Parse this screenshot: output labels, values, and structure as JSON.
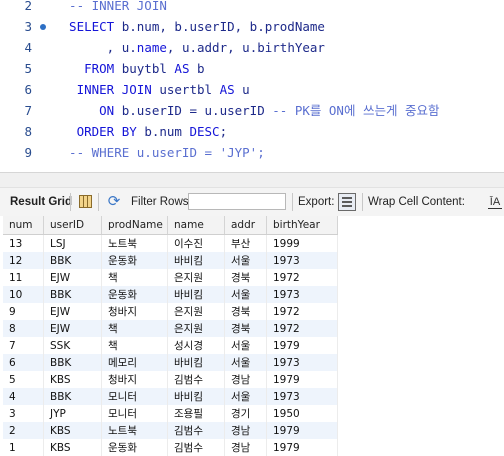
{
  "editor": {
    "lines": [
      {
        "num": "2",
        "segments": [
          {
            "t": "  -- INNER JOIN",
            "c": "cmt"
          }
        ]
      },
      {
        "num": "3",
        "marker": true,
        "segments": [
          {
            "t": "  SELECT ",
            "c": "kw"
          },
          {
            "t": "b.num, b.userID, b.prodName",
            "c": "id"
          }
        ]
      },
      {
        "num": "4",
        "segments": [
          {
            "t": "       , u.",
            "c": "id"
          },
          {
            "t": "name",
            "c": "kw"
          },
          {
            "t": ", u.addr, u.birthYear",
            "c": "id"
          }
        ]
      },
      {
        "num": "5",
        "segments": [
          {
            "t": "    FROM ",
            "c": "kw"
          },
          {
            "t": "buytbl ",
            "c": "id"
          },
          {
            "t": "AS ",
            "c": "kw"
          },
          {
            "t": "b",
            "c": "id"
          }
        ]
      },
      {
        "num": "6",
        "segments": [
          {
            "t": "   INNER JOIN ",
            "c": "kw"
          },
          {
            "t": "usertbl ",
            "c": "id"
          },
          {
            "t": "AS ",
            "c": "kw"
          },
          {
            "t": "u",
            "c": "id"
          }
        ]
      },
      {
        "num": "7",
        "segments": [
          {
            "t": "      ON ",
            "c": "kw"
          },
          {
            "t": "b.userID = u.userID ",
            "c": "id"
          },
          {
            "t": "-- PK를 ON에 쓰는게 중요함",
            "c": "cmt"
          }
        ]
      },
      {
        "num": "8",
        "segments": [
          {
            "t": "   ORDER BY ",
            "c": "kw"
          },
          {
            "t": "b.num ",
            "c": "id"
          },
          {
            "t": "DESC",
            "c": "kw"
          },
          {
            "t": ";",
            "c": "id"
          }
        ]
      },
      {
        "num": "9",
        "segments": [
          {
            "t": "  -- WHERE u.userID = 'JYP';",
            "c": "cmt"
          }
        ]
      }
    ]
  },
  "toolbar": {
    "result_grid_label": "Result Grid",
    "grid_icon": "grid-icon",
    "refresh_icon": "refresh-icon",
    "filter_label": "Filter Rows:",
    "filter_value": "",
    "export_label": "Export:",
    "export_icon": "export-icon",
    "wrap_label": "Wrap Cell Content:",
    "wrap_icon": "wrap-icon"
  },
  "grid": {
    "columns": [
      "num",
      "userID",
      "prodName",
      "name",
      "addr",
      "birthYear"
    ],
    "rows": [
      [
        "13",
        "LSJ",
        "노트북",
        "이수진",
        "부산",
        "1999"
      ],
      [
        "12",
        "BBK",
        "운동화",
        "바비킴",
        "서울",
        "1973"
      ],
      [
        "11",
        "EJW",
        "책",
        "은지원",
        "경북",
        "1972"
      ],
      [
        "10",
        "BBK",
        "운동화",
        "바비킴",
        "서울",
        "1973"
      ],
      [
        "9",
        "EJW",
        "청바지",
        "은지원",
        "경북",
        "1972"
      ],
      [
        "8",
        "EJW",
        "책",
        "은지원",
        "경북",
        "1972"
      ],
      [
        "7",
        "SSK",
        "책",
        "성시경",
        "서울",
        "1979"
      ],
      [
        "6",
        "BBK",
        "메모리",
        "바비킴",
        "서울",
        "1973"
      ],
      [
        "5",
        "KBS",
        "청바지",
        "김범수",
        "경남",
        "1979"
      ],
      [
        "4",
        "BBK",
        "모니터",
        "바비킴",
        "서울",
        "1973"
      ],
      [
        "3",
        "JYP",
        "모니터",
        "조용필",
        "경기",
        "1950"
      ],
      [
        "2",
        "KBS",
        "노트북",
        "김범수",
        "경남",
        "1979"
      ],
      [
        "1",
        "KBS",
        "운동화",
        "김범수",
        "경남",
        "1979"
      ]
    ]
  }
}
